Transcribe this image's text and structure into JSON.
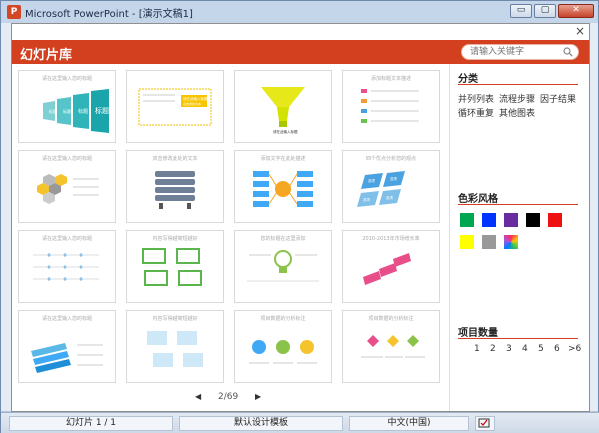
{
  "window": {
    "title": "Microsoft PowerPoint - [演示文稿1]",
    "buttons": [
      "▭",
      "▢",
      "✕"
    ]
  },
  "dialog": {
    "title": "幻灯片库",
    "search_placeholder": "请输入关键字",
    "close": "×"
  },
  "thumbnails": [
    {
      "caption": "请在这里输入您的标题",
      "labels": [
        "标题",
        "标题",
        "标题",
        "标题"
      ]
    },
    {
      "caption": "",
      "labels": [
        "请在此输入标题",
        "点击添加文本"
      ]
    },
    {
      "caption": "",
      "labels": [
        "请在此输入标题"
      ]
    },
    {
      "caption": "添加标题文本描述",
      "labels": []
    },
    {
      "caption": "请在这里输入您的标题",
      "labels": []
    },
    {
      "caption": "双击修改此处的文本",
      "labels": []
    },
    {
      "caption": "添加文字在此处描述",
      "labels": []
    },
    {
      "caption": "四个优点分析您的观点",
      "labels": [
        "选项",
        "选项",
        "选项",
        "选项"
      ]
    },
    {
      "caption": "请在这里输入您的标题",
      "labels": []
    },
    {
      "caption": "内容写得越简短越好",
      "labels": []
    },
    {
      "caption": "您的标题在这里添加",
      "labels": []
    },
    {
      "caption": "2010-2013年市场增长率",
      "labels": []
    },
    {
      "caption": "请在这里输入您的标题",
      "labels": []
    },
    {
      "caption": "内容写得越简短越好",
      "labels": []
    },
    {
      "caption": "项目数据的分析标注",
      "labels": []
    },
    {
      "caption": "项目数据的分析标注",
      "labels": []
    }
  ],
  "pager": {
    "prev": "◀",
    "text": "2/69",
    "next": "▶"
  },
  "categories": {
    "title": "分类",
    "items": [
      "并列列表",
      "流程步骤",
      "因子结果",
      "循环重复",
      "其他图表"
    ]
  },
  "colors": {
    "title": "色彩风格",
    "swatches": [
      "#00a651",
      "#0033ff",
      "#6a2aa0",
      "#000000",
      "#ee1111",
      "#ffff00",
      "#999999",
      "multicolor"
    ]
  },
  "counts": {
    "title": "项目数量",
    "items": [
      "1",
      "2",
      "3",
      "4",
      "5",
      "6",
      ">6"
    ]
  },
  "statusbar": {
    "slide": "幻灯片 1 / 1",
    "template": "默认设计模板",
    "language": "中文(中国)",
    "accent": "#d2401f"
  }
}
